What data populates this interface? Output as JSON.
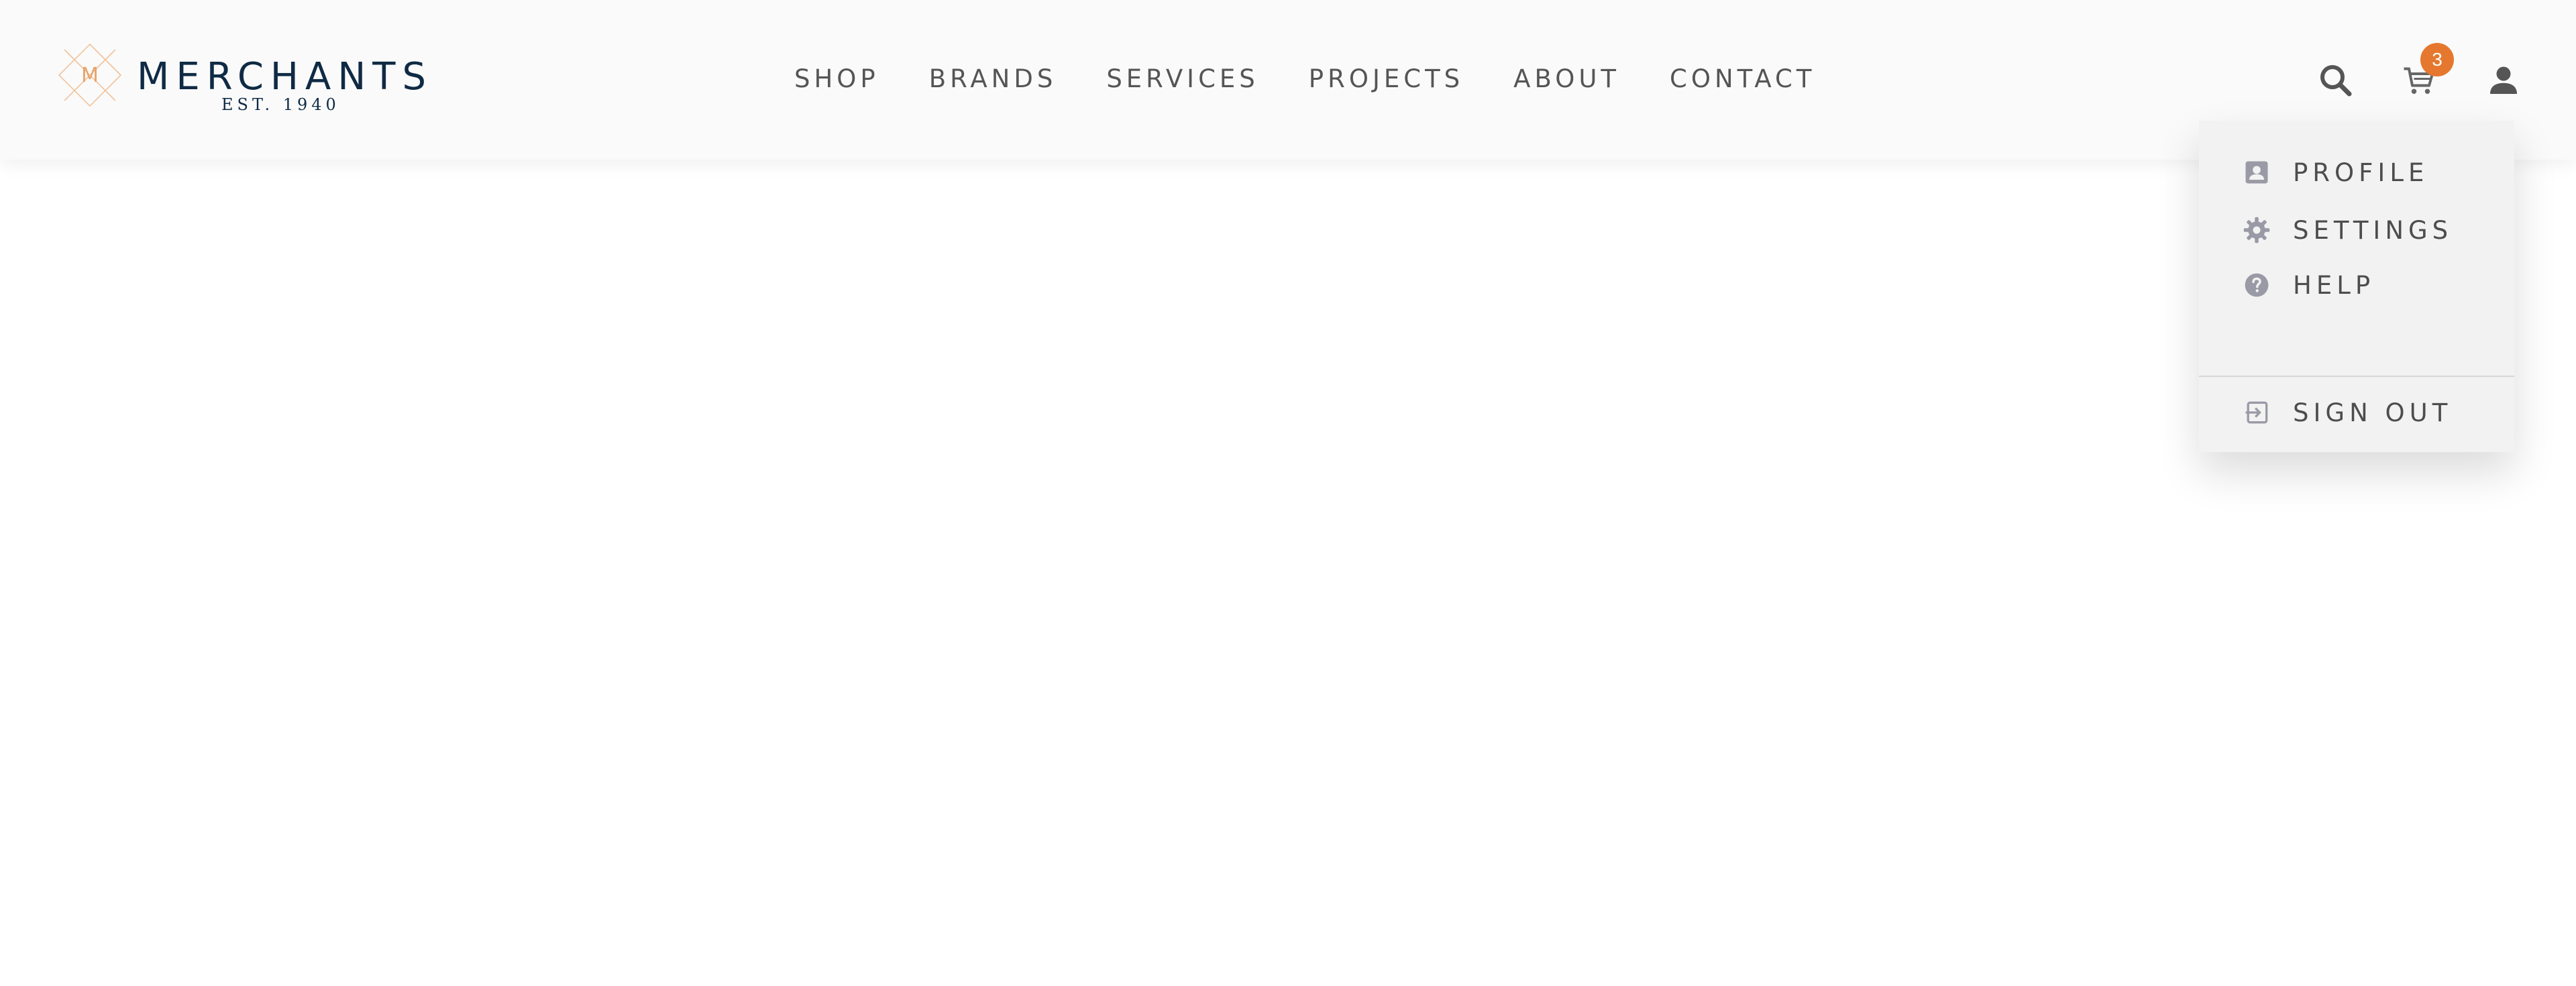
{
  "brand": {
    "name": "MERCHANTS",
    "established": "EST. 1940",
    "monogram": "M",
    "accent_color": "#e5a46b",
    "primary_color": "#0f2a44"
  },
  "nav": {
    "items": [
      {
        "label": "SHOP"
      },
      {
        "label": "BRANDS"
      },
      {
        "label": "SERVICES"
      },
      {
        "label": "PROJECTS"
      },
      {
        "label": "ABOUT"
      },
      {
        "label": "CONTACT"
      }
    ]
  },
  "header_actions": {
    "search_icon": "search-icon",
    "cart_icon": "cart-icon",
    "cart_count": "3",
    "cart_badge_color": "#e5782e",
    "user_icon": "user-icon"
  },
  "user_menu": {
    "items": [
      {
        "label": "PROFILE",
        "icon": "profile-icon"
      },
      {
        "label": "SETTINGS",
        "icon": "gear-icon"
      },
      {
        "label": "HELP",
        "icon": "help-icon"
      }
    ],
    "sign_out": {
      "label": "SIGN OUT",
      "icon": "sign-out-icon"
    }
  }
}
